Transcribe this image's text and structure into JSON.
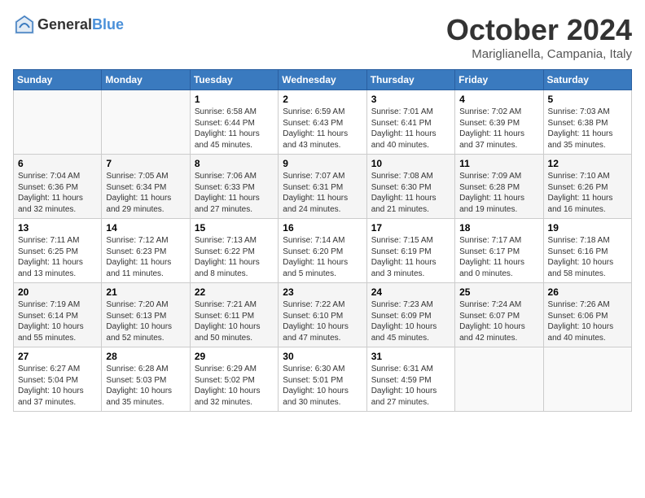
{
  "header": {
    "logo_general": "General",
    "logo_blue": "Blue",
    "month": "October 2024",
    "location": "Mariglianella, Campania, Italy"
  },
  "weekdays": [
    "Sunday",
    "Monday",
    "Tuesday",
    "Wednesday",
    "Thursday",
    "Friday",
    "Saturday"
  ],
  "weeks": [
    [
      {
        "day": "",
        "sunrise": "",
        "sunset": "",
        "daylight": ""
      },
      {
        "day": "",
        "sunrise": "",
        "sunset": "",
        "daylight": ""
      },
      {
        "day": "1",
        "sunrise": "Sunrise: 6:58 AM",
        "sunset": "Sunset: 6:44 PM",
        "daylight": "Daylight: 11 hours and 45 minutes."
      },
      {
        "day": "2",
        "sunrise": "Sunrise: 6:59 AM",
        "sunset": "Sunset: 6:43 PM",
        "daylight": "Daylight: 11 hours and 43 minutes."
      },
      {
        "day": "3",
        "sunrise": "Sunrise: 7:01 AM",
        "sunset": "Sunset: 6:41 PM",
        "daylight": "Daylight: 11 hours and 40 minutes."
      },
      {
        "day": "4",
        "sunrise": "Sunrise: 7:02 AM",
        "sunset": "Sunset: 6:39 PM",
        "daylight": "Daylight: 11 hours and 37 minutes."
      },
      {
        "day": "5",
        "sunrise": "Sunrise: 7:03 AM",
        "sunset": "Sunset: 6:38 PM",
        "daylight": "Daylight: 11 hours and 35 minutes."
      }
    ],
    [
      {
        "day": "6",
        "sunrise": "Sunrise: 7:04 AM",
        "sunset": "Sunset: 6:36 PM",
        "daylight": "Daylight: 11 hours and 32 minutes."
      },
      {
        "day": "7",
        "sunrise": "Sunrise: 7:05 AM",
        "sunset": "Sunset: 6:34 PM",
        "daylight": "Daylight: 11 hours and 29 minutes."
      },
      {
        "day": "8",
        "sunrise": "Sunrise: 7:06 AM",
        "sunset": "Sunset: 6:33 PM",
        "daylight": "Daylight: 11 hours and 27 minutes."
      },
      {
        "day": "9",
        "sunrise": "Sunrise: 7:07 AM",
        "sunset": "Sunset: 6:31 PM",
        "daylight": "Daylight: 11 hours and 24 minutes."
      },
      {
        "day": "10",
        "sunrise": "Sunrise: 7:08 AM",
        "sunset": "Sunset: 6:30 PM",
        "daylight": "Daylight: 11 hours and 21 minutes."
      },
      {
        "day": "11",
        "sunrise": "Sunrise: 7:09 AM",
        "sunset": "Sunset: 6:28 PM",
        "daylight": "Daylight: 11 hours and 19 minutes."
      },
      {
        "day": "12",
        "sunrise": "Sunrise: 7:10 AM",
        "sunset": "Sunset: 6:26 PM",
        "daylight": "Daylight: 11 hours and 16 minutes."
      }
    ],
    [
      {
        "day": "13",
        "sunrise": "Sunrise: 7:11 AM",
        "sunset": "Sunset: 6:25 PM",
        "daylight": "Daylight: 11 hours and 13 minutes."
      },
      {
        "day": "14",
        "sunrise": "Sunrise: 7:12 AM",
        "sunset": "Sunset: 6:23 PM",
        "daylight": "Daylight: 11 hours and 11 minutes."
      },
      {
        "day": "15",
        "sunrise": "Sunrise: 7:13 AM",
        "sunset": "Sunset: 6:22 PM",
        "daylight": "Daylight: 11 hours and 8 minutes."
      },
      {
        "day": "16",
        "sunrise": "Sunrise: 7:14 AM",
        "sunset": "Sunset: 6:20 PM",
        "daylight": "Daylight: 11 hours and 5 minutes."
      },
      {
        "day": "17",
        "sunrise": "Sunrise: 7:15 AM",
        "sunset": "Sunset: 6:19 PM",
        "daylight": "Daylight: 11 hours and 3 minutes."
      },
      {
        "day": "18",
        "sunrise": "Sunrise: 7:17 AM",
        "sunset": "Sunset: 6:17 PM",
        "daylight": "Daylight: 11 hours and 0 minutes."
      },
      {
        "day": "19",
        "sunrise": "Sunrise: 7:18 AM",
        "sunset": "Sunset: 6:16 PM",
        "daylight": "Daylight: 10 hours and 58 minutes."
      }
    ],
    [
      {
        "day": "20",
        "sunrise": "Sunrise: 7:19 AM",
        "sunset": "Sunset: 6:14 PM",
        "daylight": "Daylight: 10 hours and 55 minutes."
      },
      {
        "day": "21",
        "sunrise": "Sunrise: 7:20 AM",
        "sunset": "Sunset: 6:13 PM",
        "daylight": "Daylight: 10 hours and 52 minutes."
      },
      {
        "day": "22",
        "sunrise": "Sunrise: 7:21 AM",
        "sunset": "Sunset: 6:11 PM",
        "daylight": "Daylight: 10 hours and 50 minutes."
      },
      {
        "day": "23",
        "sunrise": "Sunrise: 7:22 AM",
        "sunset": "Sunset: 6:10 PM",
        "daylight": "Daylight: 10 hours and 47 minutes."
      },
      {
        "day": "24",
        "sunrise": "Sunrise: 7:23 AM",
        "sunset": "Sunset: 6:09 PM",
        "daylight": "Daylight: 10 hours and 45 minutes."
      },
      {
        "day": "25",
        "sunrise": "Sunrise: 7:24 AM",
        "sunset": "Sunset: 6:07 PM",
        "daylight": "Daylight: 10 hours and 42 minutes."
      },
      {
        "day": "26",
        "sunrise": "Sunrise: 7:26 AM",
        "sunset": "Sunset: 6:06 PM",
        "daylight": "Daylight: 10 hours and 40 minutes."
      }
    ],
    [
      {
        "day": "27",
        "sunrise": "Sunrise: 6:27 AM",
        "sunset": "Sunset: 5:04 PM",
        "daylight": "Daylight: 10 hours and 37 minutes."
      },
      {
        "day": "28",
        "sunrise": "Sunrise: 6:28 AM",
        "sunset": "Sunset: 5:03 PM",
        "daylight": "Daylight: 10 hours and 35 minutes."
      },
      {
        "day": "29",
        "sunrise": "Sunrise: 6:29 AM",
        "sunset": "Sunset: 5:02 PM",
        "daylight": "Daylight: 10 hours and 32 minutes."
      },
      {
        "day": "30",
        "sunrise": "Sunrise: 6:30 AM",
        "sunset": "Sunset: 5:01 PM",
        "daylight": "Daylight: 10 hours and 30 minutes."
      },
      {
        "day": "31",
        "sunrise": "Sunrise: 6:31 AM",
        "sunset": "Sunset: 4:59 PM",
        "daylight": "Daylight: 10 hours and 27 minutes."
      },
      {
        "day": "",
        "sunrise": "",
        "sunset": "",
        "daylight": ""
      },
      {
        "day": "",
        "sunrise": "",
        "sunset": "",
        "daylight": ""
      }
    ]
  ]
}
